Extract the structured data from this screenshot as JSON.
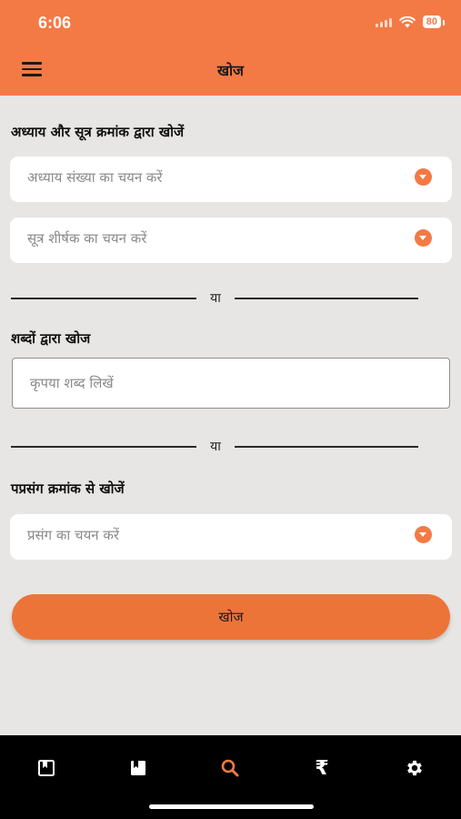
{
  "status": {
    "time": "6:06",
    "battery": "80"
  },
  "header": {
    "title": "खोज"
  },
  "section_chapter": {
    "label": "अध्याय और सूत्र क्रमांक द्वारा खोजें",
    "chapter_placeholder": "अध्याय संख्या का चयन करें",
    "sutra_placeholder": "सूत्र शीर्षक का चयन करें"
  },
  "divider_text": "या",
  "section_words": {
    "label": "शब्दों द्वारा खोज",
    "placeholder": "कृपया शब्द लिखें"
  },
  "section_prasang": {
    "label": "पप्रसंग क्रमांक से खोजें",
    "placeholder": "प्रसंग का चयन करें"
  },
  "search_button": "खोज",
  "tabbar": {
    "items": [
      {
        "icon": "bookmark-book-icon",
        "active": false
      },
      {
        "icon": "book-icon",
        "active": false
      },
      {
        "icon": "search-icon",
        "active": true
      },
      {
        "icon": "rupee-icon",
        "glyph": "₹",
        "active": false
      },
      {
        "icon": "gear-icon",
        "active": false
      }
    ]
  },
  "colors": {
    "accent": "#f47a45",
    "button": "#ed7438",
    "background": "#e8e6e4",
    "tabbar": "#000000"
  }
}
